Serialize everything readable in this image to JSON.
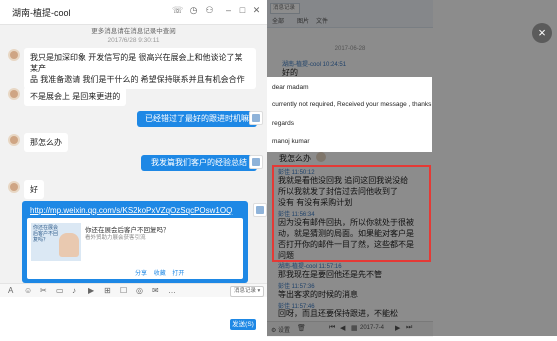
{
  "window": {
    "title": "湖南-植提-cool",
    "history_link": "更多消息请在消息记录中查阅",
    "timestamp": "2017/6/28 9:30:11"
  },
  "messages": {
    "m1": [
      "我只是加深印象 开发信写的是 很高兴在展会上和他谈论了某某产",
      "品 我准备邀请 我们是干什么的 希望保持联系并且有机会合作"
    ],
    "m2": "不是展会上  是回来更进的",
    "m3": "已经错过了最好的跟进时机嘛",
    "m4": "那怎么办",
    "m5": "我发篇我们客户的经验总结",
    "m6": "好"
  },
  "share": {
    "link": "http://mp.weixin.qq.com/s/KS2koPxVZqOzSqcPOsw1OQ",
    "title": "你还在展会后客户不回复吗？",
    "desc": "看外贸助力展会获客引流",
    "thumb_text": "你还在展会后客户不回复吗？",
    "actions": [
      "分享",
      "收藏",
      "打开"
    ]
  },
  "input": {
    "tools": [
      "A",
      "☺",
      "✂",
      "▭",
      "♪",
      "▶",
      "⊞",
      "☐",
      "◎",
      "✉",
      "…"
    ],
    "history_button": "消息记录 ▾",
    "send_button": "发送(S) ▾"
  },
  "panel": {
    "search_placeholder": "消息记录",
    "tabs": [
      "全部",
      "图片",
      "文件"
    ],
    "date1": "2017-06-28",
    "h1_meta": "湖南-植提-cool 10:24:51",
    "h1_text": "好的",
    "h2_text": "我怎么办",
    "h3_meta": "彭佳 11:50:12",
    "h3_lines": [
      "我就是看他没回我 追问这回我说没给",
      "所以我就发了封信过去问他收到了",
      "没有 有没有采购计划"
    ],
    "h4_meta": "彭佳 11:56:34",
    "h4_lines": [
      "因为没有邮件回执，所以你就处于很被",
      "动，就是猜测的局面。如果能对客户是",
      "否打开你的邮件一目了然，这些都不是",
      "问题"
    ],
    "h5_meta": "湖南-植提-cool 11:57:16",
    "h5_text": "那我现在是要回他还是先不管",
    "h6_meta": "彭佳 11:57:36",
    "h6_text": "等出客求的时候的消息",
    "h7_meta": "彭佳 11:57:46",
    "h7_lines": [
      "回呀，而且还要保持跟进，不能松",
      "懈"
    ],
    "footer_settings": "设置",
    "footer_date": "2017-7-4"
  },
  "email": {
    "greeting": "dear madam",
    "body": "currently not required, Received your message , thanks",
    "closing": "regards",
    "signature": "manoj kumar"
  },
  "overlay_close": "×"
}
